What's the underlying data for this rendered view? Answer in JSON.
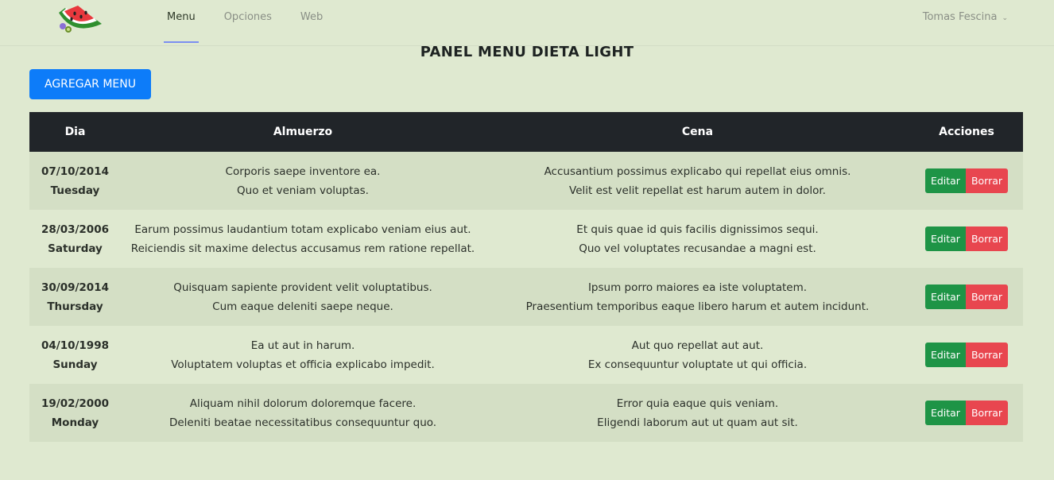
{
  "nav": {
    "links": [
      "Menu",
      "Opciones",
      "Web"
    ],
    "active": "Menu",
    "user": "Tomas Fescina"
  },
  "page": {
    "title": "PANEL MENU DIETA LIGHT",
    "add_button": "AGREGAR MENU"
  },
  "table": {
    "headers": [
      "Dia",
      "Almuerzo",
      "Cena",
      "Acciones"
    ],
    "edit_label": "Editar",
    "delete_label": "Borrar",
    "rows": [
      {
        "date": "07/10/2014",
        "weekday": "Tuesday",
        "almuerzo": [
          "Corporis saepe inventore ea.",
          "Quo et veniam voluptas."
        ],
        "cena": [
          "Accusantium possimus explicabo qui repellat eius omnis.",
          "Velit est velit repellat est harum autem in dolor."
        ]
      },
      {
        "date": "28/03/2006",
        "weekday": "Saturday",
        "almuerzo": [
          "Earum possimus laudantium totam explicabo veniam eius aut.",
          "Reiciendis sit maxime delectus accusamus rem ratione repellat."
        ],
        "cena": [
          "Et quis quae id quis facilis dignissimos sequi.",
          "Quo vel voluptates recusandae a magni est."
        ]
      },
      {
        "date": "30/09/2014",
        "weekday": "Thursday",
        "almuerzo": [
          "Quisquam sapiente provident velit voluptatibus.",
          "Cum eaque deleniti saepe neque."
        ],
        "cena": [
          "Ipsum porro maiores ea iste voluptatem.",
          "Praesentium temporibus eaque libero harum et autem incidunt."
        ]
      },
      {
        "date": "04/10/1998",
        "weekday": "Sunday",
        "almuerzo": [
          "Ea ut aut in harum.",
          "Voluptatem voluptas et officia explicabo impedit."
        ],
        "cena": [
          "Aut quo repellat aut aut.",
          "Ex consequuntur voluptate ut qui officia."
        ]
      },
      {
        "date": "19/02/2000",
        "weekday": "Monday",
        "almuerzo": [
          "Aliquam nihil dolorum doloremque facere.",
          "Deleniti beatae necessitatibus consequuntur quo."
        ],
        "cena": [
          "Error quia eaque quis veniam.",
          "Eligendi laborum aut ut quam aut sit."
        ]
      }
    ]
  },
  "colors": {
    "background": "#dfe9d0",
    "header_dark": "#212529",
    "primary": "#0d7cf9",
    "edit": "#1e9446",
    "delete": "#e8464f"
  },
  "icons": {
    "logo": "watermelon-logo-icon",
    "user_menu": "chevron-down-icon"
  }
}
